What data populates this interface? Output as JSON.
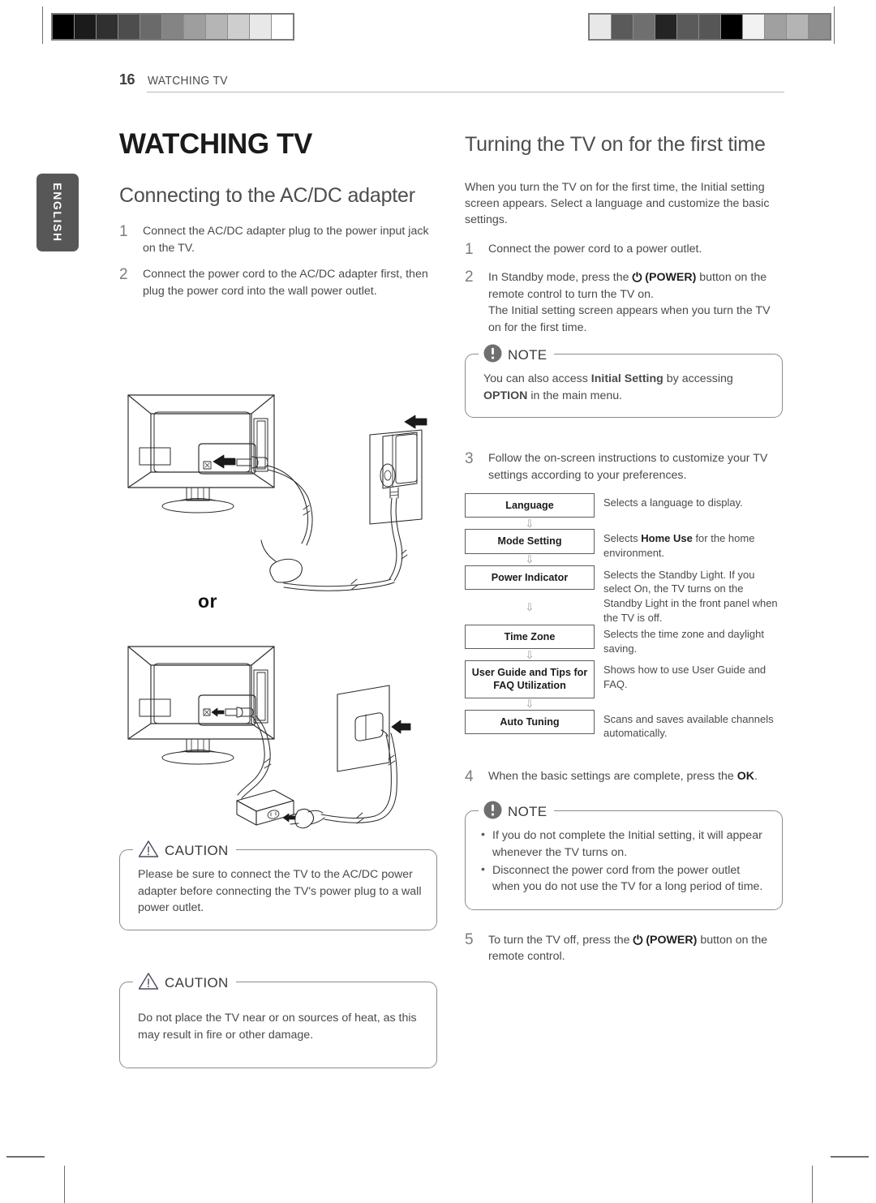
{
  "runhead": {
    "page_number": "16",
    "section": "WATCHING TV"
  },
  "language_tab": {
    "label": "ENGLISH"
  },
  "left_column": {
    "page_title": "WATCHING TV",
    "section_title": "Connecting to the AC/DC adapter",
    "steps": [
      {
        "num": "1",
        "text": "Connect the AC/DC adapter plug to the power input jack on the TV."
      },
      {
        "num": "2",
        "text": "Connect the power cord to the AC/DC adapter first, then plug the power cord into the wall power outlet."
      }
    ],
    "or_label": "or",
    "cautions": [
      {
        "caption": "CAUTION",
        "icon": "warning-triangle-icon",
        "text": "Please be sure to connect the TV to the AC/DC power adapter before connecting the TV's power plug to a wall power outlet."
      },
      {
        "caption": "CAUTION",
        "icon": "warning-triangle-icon",
        "text": "Do not place the TV near or on sources of heat, as this may result in fire or other damage."
      }
    ]
  },
  "right_column": {
    "section_title": "Turning the TV on for the first time",
    "intro": "When you turn the TV on for the first time, the Initial setting screen appears. Select a language and customize the basic settings.",
    "step1": {
      "num": "1",
      "text": "Connect the power cord to a power outlet."
    },
    "step2": {
      "num": "2",
      "line1_a": "In Standby mode, press the ",
      "power_glyph": "⏻",
      "line1_b": " (POWER)",
      "line1_c": " button on the remote control to turn the TV on.",
      "line2": "The Initial setting screen appears when you turn the TV on for the first time."
    },
    "note1": {
      "caption": "NOTE",
      "icon": "exclamation-circle-icon",
      "text_a": "You can also access ",
      "bold_a": "Initial Setting",
      "text_b": " by accessing ",
      "bold_b": "OPTION",
      "text_c": " in the main menu."
    },
    "step3": {
      "num": "3",
      "text": "Follow the on-screen instructions to customize your TV settings according to your preferences."
    },
    "flow": {
      "items": [
        {
          "box": "Language",
          "desc_plain": "Selects a language to display."
        },
        {
          "box": "Mode Setting",
          "desc_a": "Selects ",
          "desc_bold": "Home Use",
          "desc_b": " for the home environment."
        },
        {
          "box": "Power Indicator",
          "desc_plain": "Selects the Standby Light. If you select On, the TV turns on the Standby Light in the front panel when the TV is off."
        },
        {
          "box": "Time Zone",
          "desc_plain": "Selects the time zone and daylight saving."
        },
        {
          "box": "User Guide and Tips for FAQ Utilization",
          "desc_plain": "Shows how to use User Guide and FAQ."
        },
        {
          "box": "Auto Tuning",
          "desc_plain": "Scans and saves available channels automatically."
        }
      ],
      "arrow_glyph": "⇩"
    },
    "step4": {
      "num": "4",
      "text_a": "When the basic settings are complete, press the ",
      "bold": "OK",
      "text_b": "."
    },
    "note2": {
      "caption": "NOTE",
      "icon": "exclamation-circle-icon",
      "bullets": [
        "If you do not complete the Initial setting, it will appear whenever the TV turns on.",
        "Disconnect the power cord from the power outlet when you do not use the TV for a long period of time."
      ]
    },
    "step5": {
      "num": "5",
      "text_a": "To turn the TV off, press the ",
      "power_glyph": "⏻",
      "text_b": " (POWER)",
      "text_c": " button on the remote control."
    }
  },
  "registration": {
    "left_bar_swatches": [
      "#000000",
      "#1b1b1b",
      "#303030",
      "#4d4d4d",
      "#6a6a6a",
      "#848484",
      "#9e9e9e",
      "#b5b5b5",
      "#cecece",
      "#e8e8e8",
      "#ffffff"
    ],
    "right_bar_swatches": [
      "#e8e8e8",
      "#5a5a5a",
      "#6f6f6f",
      "#242424",
      "#5a5a5a",
      "#565656",
      "#000000",
      "#f2f2f2",
      "#a0a0a0",
      "#b4b4b4",
      "#8e8e8e"
    ]
  }
}
